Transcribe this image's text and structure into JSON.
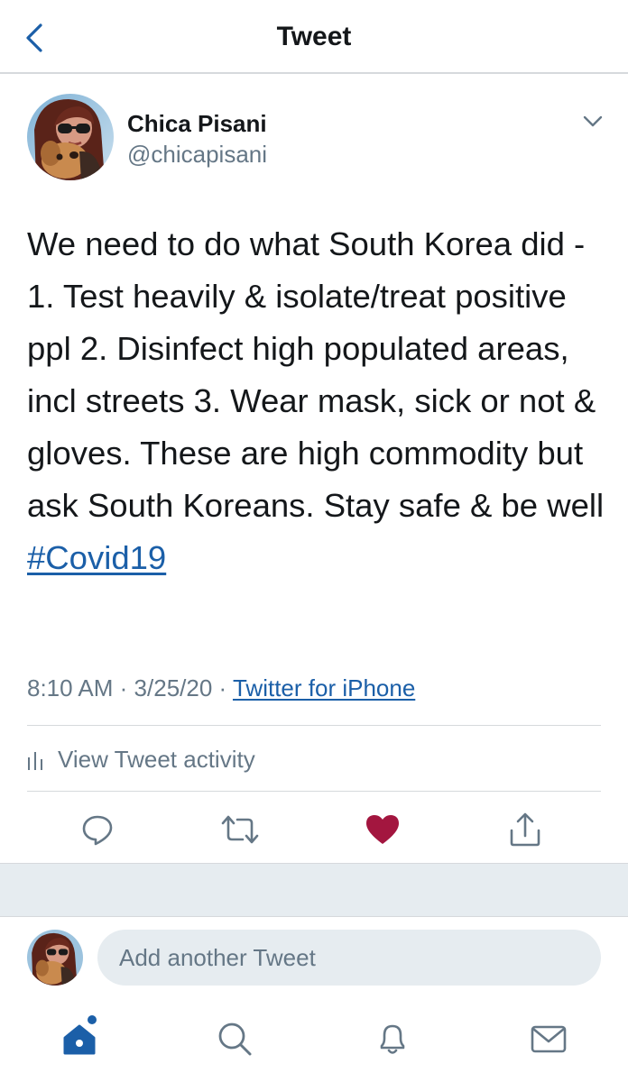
{
  "header": {
    "title": "Tweet",
    "back_icon": "chevron-left-icon"
  },
  "tweet": {
    "author": {
      "display_name": "Chica Pisani",
      "handle": "@chicapisani",
      "avatar": "avatar-photo-woman-with-dog"
    },
    "text": "We need to do what South Korea did - 1. Test heavily & isolate/treat positive ppl 2. Disinfect high populated areas, incl streets 3. Wear mask, sick or not & gloves. These are high commodity but ask South Koreans. Stay safe & be well",
    "hashtag": "#Covid19",
    "time": "8:10 AM",
    "separator": "·",
    "date": "3/25/20",
    "source": "Twitter for iPhone",
    "activity_label": "View Tweet activity",
    "liked": true
  },
  "actions": [
    {
      "name": "reply",
      "icon": "reply-icon"
    },
    {
      "name": "retweet",
      "icon": "retweet-icon"
    },
    {
      "name": "like",
      "icon": "heart-filled-icon",
      "color": "#e0245e"
    },
    {
      "name": "share",
      "icon": "share-icon"
    }
  ],
  "compose": {
    "placeholder": "Add another Tweet"
  },
  "tab_bar": [
    {
      "name": "home",
      "icon": "home-icon",
      "active": true
    },
    {
      "name": "search",
      "icon": "search-icon"
    },
    {
      "name": "notifications",
      "icon": "bell-icon"
    },
    {
      "name": "messages",
      "icon": "mail-icon"
    }
  ],
  "colors": {
    "accent": "#1b5fa8",
    "like": "#a3163f",
    "text": "#14171a",
    "secondary": "#657786",
    "divider": "#d6d9dc"
  }
}
